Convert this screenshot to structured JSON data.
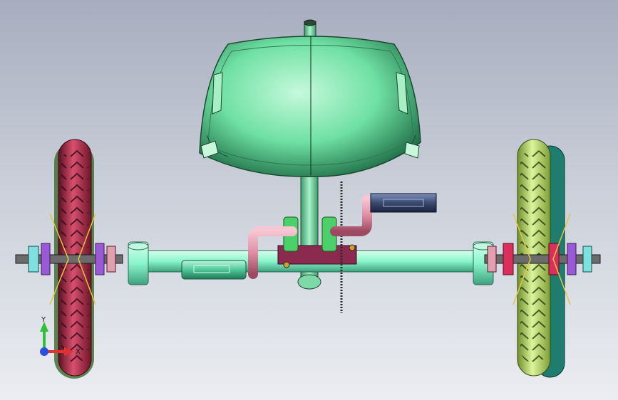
{
  "viewport": {
    "background_top": "#a6adbe",
    "background_bottom": "#ebedf1"
  },
  "model": {
    "seat_color": "#5fdc9a",
    "frame_color": "#8af5cc",
    "crank_color": "#e08ea4",
    "pedal_color": "#3b4a6e",
    "left_wheel_color": "#c0304e",
    "right_wheel_color": "#b9e07a",
    "right_wheel_back_color": "#1e7d6e"
  },
  "triad": {
    "x_label": "X",
    "y_label": "Y",
    "x_axis_color": "#e03030",
    "y_axis_color": "#2fbf3a",
    "z_axis_color": "#2a4fe0"
  }
}
